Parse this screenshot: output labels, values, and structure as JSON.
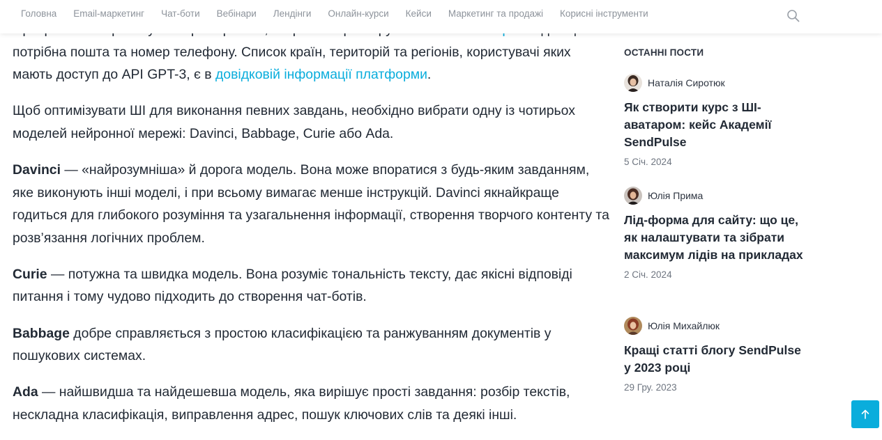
{
  "nav": {
    "items": [
      "Головна",
      "Email-маркетинг",
      "Чат-боти",
      "Вебінари",
      "Лендінги",
      "Онлайн-курси",
      "Кейси",
      "Маркетинг та продажі",
      "Корисні інструменти"
    ]
  },
  "article": {
    "p1": {
      "partial_text": "Щоб розпочати роботу з нейромережею, потрібно зареєструватися на ",
      "link1": "сайті OpenAI",
      "text2": " для цього потрібна пошта та номер телефону. Список країн, територій та регіонів, користувачі яких мають доступ до API GPT-3, є в ",
      "link2": "довідковій інформації платформи",
      "text3": "."
    },
    "p2": "Щоб оптимізувати ШІ для виконання певних завдань, необхідно вибрати одну із чотирьох моделей нейронної мережі: Davinci, Babbage, Curie або Ada.",
    "p3": {
      "term": "Davinci",
      "text": " — «найрозумніша» й дорога модель. Вона може впоратися з будь-яким завданням, яке виконують інші моделі, і при всьому вимагає менше інструкцій. Davinci якнайкраще годиться для глибокого розуміння та узагальнення інформації, створення творчого контенту та розв’язання логічних проблем."
    },
    "p4": {
      "term": "Curie",
      "text": " — потужна та швидка модель. Вона розуміє тональність тексту, дає якісні відповіді питання і тому чудово підходить до створення чат-ботів."
    },
    "p5": {
      "term": "Babbage",
      "text": " добре справляється з простою класифікацією та ранжуванням документів у пошукових системах."
    },
    "p6": {
      "term": "Ada",
      "text": " — найшвидша та найдешевша модель, яка вирішує прості завдання: розбір текстів, нескладна класифікація, виправлення адрес, пошук ключових слів та деякі інші."
    }
  },
  "sidebar": {
    "heading": "ОСТАННІ ПОСТИ",
    "posts": [
      {
        "author": "Наталія Сиротюк",
        "title": "Як створити курс з ШІ-аватаром: кейс Академії SendPulse",
        "date": "5 Січ. 2024"
      },
      {
        "author": "Юлія Прима",
        "title": "Лід-форма для сайту: що це, як налаштувати та зібрати максимум лідів на прикладах",
        "date": "2 Січ. 2024"
      },
      {
        "author": "Юлія Михайлюк",
        "title": "Кращі статті блогу SendPulse у 2023 році",
        "date": "29 Гру. 2023"
      }
    ]
  },
  "icons": {
    "search": "search-icon",
    "to_top": "arrow-up-icon"
  },
  "colors": {
    "accent": "#0aaddc",
    "text": "#222a35",
    "nav_text": "#8d939b"
  }
}
